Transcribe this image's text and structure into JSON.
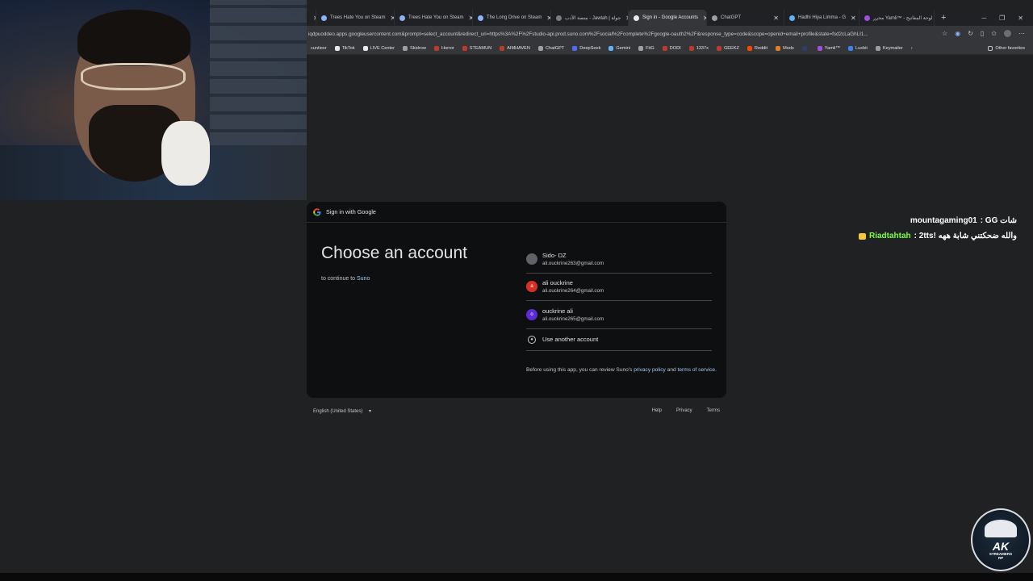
{
  "browser": {
    "tabs": [
      {
        "label": "",
        "active": false
      },
      {
        "label": "Trees Hate You on Steam",
        "active": false
      },
      {
        "label": "Trees Hate You on Steam",
        "active": false
      },
      {
        "label": "The Long Drive on Steam",
        "active": false
      },
      {
        "label": "منصة الأدب - Jawlah | جولة",
        "active": false
      },
      {
        "label": "Sign in - Google Accounts",
        "active": true
      },
      {
        "label": "ChatGPT",
        "active": false
      },
      {
        "label": "Hadhi Hiya Limma - G",
        "active": false
      },
      {
        "label": "محرر Yamli™ - لوحة المفاتيح",
        "active": false
      }
    ],
    "url": "iqdpuoddeo.apps.googleusercontent.com&prompt=select_account&redirect_uri=https%3A%2F%2Fstudio-api.prod.suno.com%2Fsocial%2Fcomplete%2Fgoogle-oauth2%2F&response_type=code&scope=openid+email+profile&state=fsd2cLaGhLI1...",
    "bookmarks": [
      "cuntiesr",
      "TikTok",
      "LIVE Center",
      "Skidrow",
      "Horror",
      "STEAMUN",
      "AIMHAVEN",
      "ChatGPT",
      "DeepSeek",
      "Gemini",
      "FitG",
      "DODI",
      "1337x",
      "GEEKZ",
      "Reddit",
      "Mods",
      "",
      "Yamli™",
      "Luxbit",
      "Keymailer"
    ],
    "other_favorites": "Other favorites"
  },
  "signin": {
    "header": "Sign in with Google",
    "title": "Choose an account",
    "subtitle_prefix": "to continue to",
    "app_name": "Suno",
    "accounts": [
      {
        "name": "Sido- DZ",
        "email": "ali.ouckrine263@gmail.com",
        "initial": "",
        "color": "#5f6368"
      },
      {
        "name": "ali ouckrine",
        "email": "ali.ouckrine264@gmail.com",
        "initial": "a",
        "color": "#d93025"
      },
      {
        "name": "ouckrine ali",
        "email": "ali.ouckrine265@gmail.com",
        "initial": "o",
        "color": "#5b2bd6"
      }
    ],
    "use_another": "Use another account",
    "policy_prefix": "Before using this app, you can review Suno's",
    "privacy_policy": "privacy policy",
    "and": "and",
    "terms_of_service": "terms of service",
    "period": "."
  },
  "footer": {
    "language": "English (United States)",
    "help": "Help",
    "privacy": "Privacy",
    "terms": "Terms"
  },
  "chat": {
    "messages": [
      {
        "user": "mountagaming01",
        "text": ": GG شات"
      },
      {
        "user": "Riadtahtah",
        "text": ": 2tts! والله ضحكتني شابة ههه"
      }
    ]
  },
  "logo": {
    "main": "AK",
    "sub": "STREAMERS",
    "sub2": "RP"
  }
}
